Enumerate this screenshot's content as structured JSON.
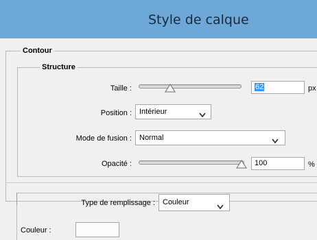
{
  "window": {
    "title": "Style de calque"
  },
  "contour": {
    "legend": "Contour",
    "structure": {
      "legend": "Structure",
      "size": {
        "label": "Taille :",
        "value": "62",
        "unit": "px",
        "slider_value": 0.33
      },
      "position": {
        "label": "Position :",
        "value": "Intérieur"
      },
      "blend_mode": {
        "label": "Mode de fusion :",
        "value": "Normal"
      },
      "opacity": {
        "label": "Opacité :",
        "value": "100",
        "unit": "%",
        "slider_value": 1.0
      }
    },
    "fill": {
      "type": {
        "label": "Type de remplissage :",
        "value": "Couleur"
      },
      "color": {
        "label": "Couleur :"
      }
    }
  },
  "icons": {
    "chevron": "chevron-down-icon",
    "thumb": "slider-thumb-icon"
  }
}
